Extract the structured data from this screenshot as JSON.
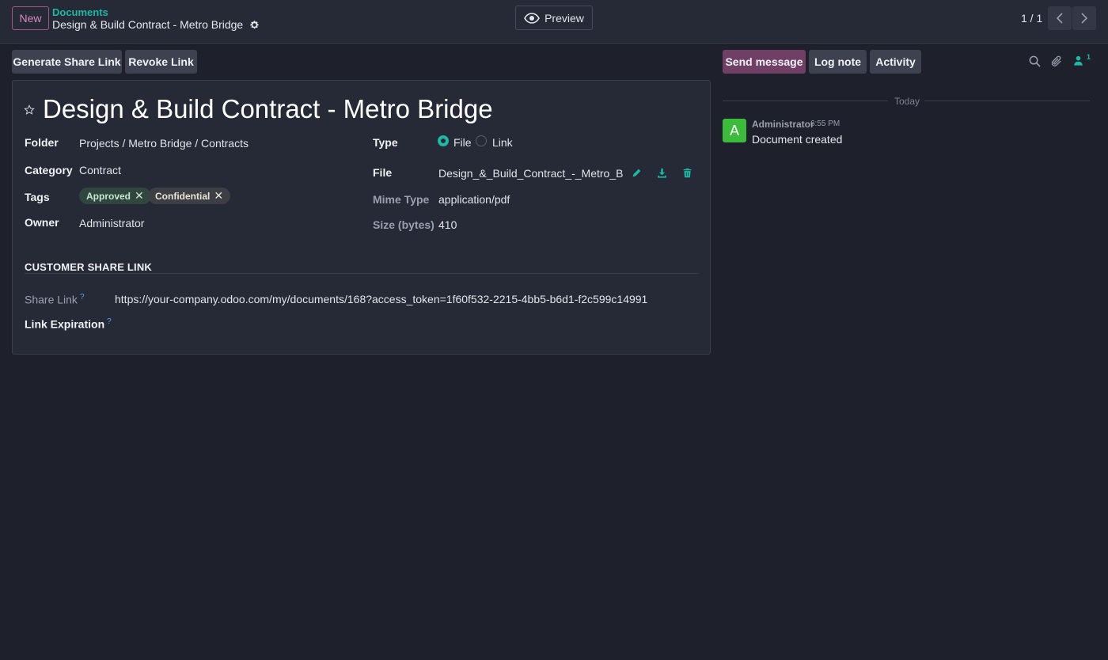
{
  "control_panel": {
    "new_label": "New",
    "breadcrumb_parent": "Documents",
    "breadcrumb_current": "Design & Build Contract - Metro Bridge",
    "preview_label": "Preview",
    "pager": "1 / 1"
  },
  "actions": {
    "generate_share_link": "Generate Share Link",
    "revoke_link": "Revoke Link"
  },
  "form": {
    "title": "Design & Build Contract - Metro Bridge",
    "left": {
      "folder_label": "Folder",
      "folder_value": "Projects / Metro Bridge / Contracts",
      "category_label": "Category",
      "category_value": "Contract",
      "tags_label": "Tags",
      "tags": [
        "Approved",
        "Confidential"
      ],
      "owner_label": "Owner",
      "owner_value": "Administrator"
    },
    "right": {
      "type_label": "Type",
      "type_options": [
        "File",
        "Link"
      ],
      "type_selected": "File",
      "file_label": "File",
      "file_value": "Design_&_Build_Contract_-_Metro_Bridg",
      "mime_label": "Mime Type",
      "mime_value": "application/pdf",
      "size_label": "Size (bytes)",
      "size_value": "410"
    },
    "share_section": {
      "title": "CUSTOMER SHARE LINK",
      "share_link_label": "Share Link",
      "share_link_value": "https://your-company.odoo.com/my/documents/168?access_token=1f60f532-2215-4bb5-b6d1-f2c599c14991",
      "link_expiration_label": "Link Expiration",
      "help_mark": "?"
    }
  },
  "chatter": {
    "send_message": "Send message",
    "log_note": "Log note",
    "activity": "Activity",
    "follower_count": "1",
    "day_separator": "Today",
    "messages": [
      {
        "avatar_letter": "A",
        "author": "Administrator",
        "time": "6:55 PM",
        "body": "Document created"
      }
    ]
  },
  "colors": {
    "accent": "#1fb7a5",
    "primary_button": "#6f3f66",
    "background": "#1e202b",
    "sheet": "#262a36"
  },
  "icons": [
    "gear-icon",
    "eye-icon",
    "chevron-left-icon",
    "chevron-right-icon",
    "star-icon",
    "pencil-icon",
    "download-icon",
    "trash-icon",
    "search-icon",
    "paperclip-icon",
    "user-icon"
  ]
}
